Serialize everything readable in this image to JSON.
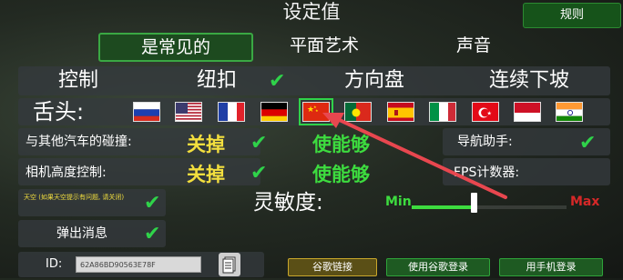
{
  "header": {
    "title": "设定值",
    "rules_label": "规则"
  },
  "tabs": [
    {
      "label": "是常见的",
      "active": true
    },
    {
      "label": "平面艺术",
      "active": false
    },
    {
      "label": "声音",
      "active": false
    }
  ],
  "controls": {
    "label": "控制",
    "buttons_label": "纽扣",
    "steering_label": "方向盘",
    "downhill_label": "连续下坡"
  },
  "language": {
    "label": "舌头:",
    "flags": [
      "russia",
      "usa",
      "france",
      "germany",
      "china",
      "portugal",
      "spain",
      "italy",
      "turkey",
      "indonesia",
      "india"
    ],
    "selected": "china"
  },
  "settings": {
    "collision_label": "与其他汽车的碰撞:",
    "collision_value": "关掉",
    "collision_enable": "使能够",
    "nav_label": "导航助手:",
    "camera_label": "相机高度控制:",
    "camera_value": "关掉",
    "camera_enable": "使能够",
    "fps_label": "FPS计数器:",
    "sky_label": "天空 (如果天空提示有问题, 请关闭)",
    "sensitivity_label": "灵敏度:",
    "sens_min": "Min",
    "sens_max": "Max",
    "sensitivity_level": 0.4,
    "popup_label": "弹出消息"
  },
  "footer": {
    "id_label": "ID:",
    "id_value": "62A86BD90563E78F",
    "google_link_label": "谷歌链接",
    "google_login_label": "使用谷歌登录",
    "phone_login_label": "用手机登录"
  },
  "colors": {
    "accent": "#2fd34a",
    "yellow": "#f3df3e",
    "max_red": "#d62828"
  }
}
